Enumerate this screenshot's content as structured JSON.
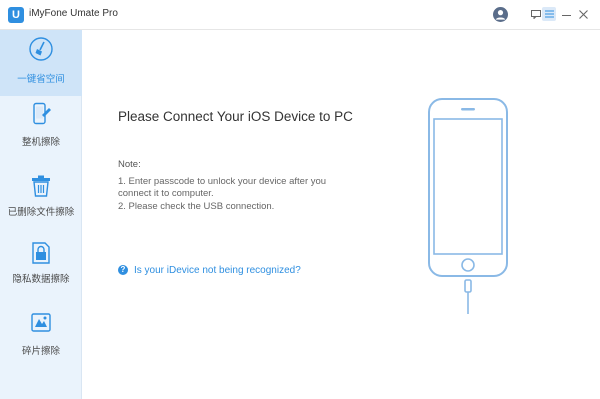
{
  "window": {
    "logo_letter": "U",
    "title": "iMyFone Umate Pro"
  },
  "titlebar_icons": [
    "account-icon",
    "feedback-icon",
    "menu-icon",
    "minimize-icon",
    "close-icon"
  ],
  "sidebar": {
    "items": [
      {
        "label": "一键省空间",
        "icon": "broom-icon",
        "active": true
      },
      {
        "label": "整机擦除",
        "icon": "phone-erase-icon",
        "active": false
      },
      {
        "label": "已删除文件擦除",
        "icon": "trash-icon",
        "active": false
      },
      {
        "label": "隐私数据擦除",
        "icon": "privacy-icon",
        "active": false
      },
      {
        "label": "碎片擦除",
        "icon": "fragment-icon",
        "active": false
      }
    ]
  },
  "main": {
    "title": "Please Connect Your iOS Device to PC",
    "note_label": "Note:",
    "note_lines": [
      "1. Enter passcode to unlock your device after you",
      "connect it to computer.",
      "2. Please check the USB connection."
    ],
    "help_icon": "?",
    "help_link": "Is your iDevice not being recognized?"
  },
  "colors": {
    "accent": "#2f8fe0",
    "sidebar_bg": "#eaf3fc",
    "sidebar_active": "#cfe4f8",
    "phone_outline": "#8ab9e6"
  }
}
